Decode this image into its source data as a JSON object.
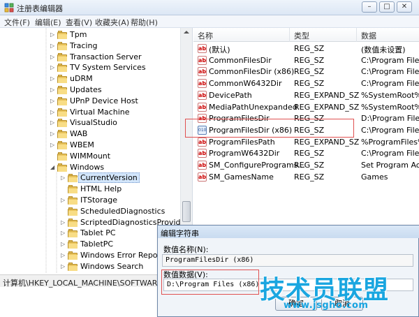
{
  "window": {
    "title": "注册表编辑器",
    "buttons": [
      "–",
      "□",
      "✕"
    ]
  },
  "menu": [
    "文件(F)",
    "编辑(E)",
    "查看(V)",
    "收藏夹(A)",
    "帮助(H)"
  ],
  "tree": {
    "items": [
      {
        "label": "Tpm",
        "expander": "▷"
      },
      {
        "label": "Tracing",
        "expander": "▷"
      },
      {
        "label": "Transaction Server",
        "expander": "▷"
      },
      {
        "label": "TV System Services",
        "expander": "▷"
      },
      {
        "label": "uDRM",
        "expander": "▷"
      },
      {
        "label": "Updates",
        "expander": "▷"
      },
      {
        "label": "UPnP Device Host",
        "expander": "▷"
      },
      {
        "label": "Virtual Machine",
        "expander": "▷"
      },
      {
        "label": "VisualStudio",
        "expander": "▷"
      },
      {
        "label": "WAB",
        "expander": "▷"
      },
      {
        "label": "WBEM",
        "expander": "▷"
      },
      {
        "label": "WIMMount",
        "expander": ""
      },
      {
        "label": "Windows",
        "expander": "◢"
      },
      {
        "label": "CurrentVersion",
        "expander": "▷",
        "selected": true
      },
      {
        "label": "HTML Help",
        "expander": ""
      },
      {
        "label": "ITStorage",
        "expander": "▷"
      },
      {
        "label": "ScheduledDiagnostics",
        "expander": ""
      },
      {
        "label": "ScriptedDiagnosticsProvider",
        "expander": "▷"
      },
      {
        "label": "Tablet PC",
        "expander": "▷"
      },
      {
        "label": "TabletPC",
        "expander": "▷"
      },
      {
        "label": "Windows Error Reporting",
        "expander": "▷"
      },
      {
        "label": "Windows Search",
        "expander": "▷"
      }
    ]
  },
  "list": {
    "columns": [
      "名称",
      "类型",
      "数据"
    ],
    "rows": [
      {
        "icon": "ab",
        "name": "(默认)",
        "type": "REG_SZ",
        "data": "(数值未设置)"
      },
      {
        "icon": "ab",
        "name": "CommonFilesDir",
        "type": "REG_SZ",
        "data": "C:\\Program Files\\"
      },
      {
        "icon": "ab",
        "name": "CommonFilesDir (x86)",
        "type": "REG_SZ",
        "data": "C:\\Program Files (x"
      },
      {
        "icon": "ab",
        "name": "CommonW6432Dir",
        "type": "REG_SZ",
        "data": "C:\\Program Files\\"
      },
      {
        "icon": "ab",
        "name": "DevicePath",
        "type": "REG_EXPAND_SZ",
        "data": "%SystemRoot%\\in"
      },
      {
        "icon": "ab",
        "name": "MediaPathUnexpanded",
        "type": "REG_EXPAND_SZ",
        "data": "%SystemRoot%\\M"
      },
      {
        "icon": "ab",
        "name": "ProgramFilesDir",
        "type": "REG_SZ",
        "data": "D:\\Program Files"
      },
      {
        "icon": "bin",
        "name": "ProgramFilesDir (x86)",
        "type": "REG_SZ",
        "data": "C:\\Program Files"
      },
      {
        "icon": "ab",
        "name": "ProgramFilesPath",
        "type": "REG_EXPAND_SZ",
        "data": "%ProgramFiles%"
      },
      {
        "icon": "ab",
        "name": "ProgramW6432Dir",
        "type": "REG_SZ",
        "data": "C:\\Program Files"
      },
      {
        "icon": "ab",
        "name": "SM_ConfigurePrograms...",
        "type": "REG_SZ",
        "data": "Set Program Acce"
      },
      {
        "icon": "ab",
        "name": "SM_GamesName",
        "type": "REG_SZ",
        "data": "Games"
      }
    ]
  },
  "status": {
    "path": "计算机\\HKEY_LOCAL_MACHINE\\SOFTWARE\\Mic"
  },
  "dialog": {
    "title": "编辑字符串",
    "name_label": "数值名称(N):",
    "name_value": "ProgramFilesDir (x86)",
    "data_label": "数值数据(V):",
    "data_value": "D:\\Program Files (x86)",
    "ok": "确定",
    "cancel": "取消"
  },
  "watermark": {
    "text": "技术员联盟",
    "url": "www.jsgho.com"
  },
  "colors": {
    "highlight": "#e05050",
    "selection": "#d3e6fb",
    "watermark": "#1aa6e0"
  }
}
